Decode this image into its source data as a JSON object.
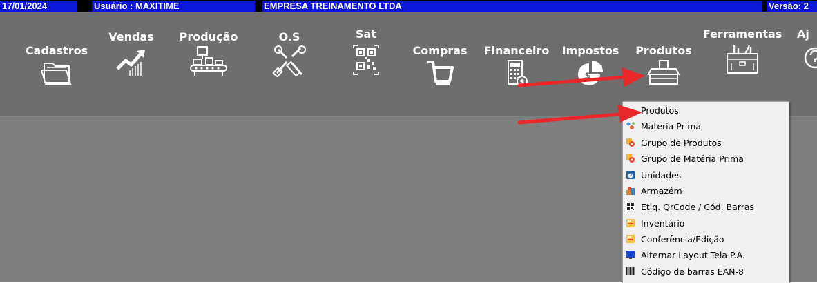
{
  "status_bar": {
    "date": "17/01/2024",
    "user": "Usuário : MAXITIME",
    "company": "EMPRESA TREINAMENTO LTDA",
    "version": "Versão: 2"
  },
  "menu": {
    "items": [
      {
        "label": "Cadastros",
        "icon": "folder-icon"
      },
      {
        "label": "Vendas",
        "icon": "trend-up-icon"
      },
      {
        "label": "Produção",
        "icon": "conveyor-icon"
      },
      {
        "label": "O.S",
        "icon": "tools-icon"
      },
      {
        "label": "Sat",
        "icon": "qrcode-icon"
      },
      {
        "label": "Compras",
        "icon": "cart-icon"
      },
      {
        "label": "Financeiro",
        "icon": "calculator-icon"
      },
      {
        "label": "Impostos",
        "icon": "pie-chart-icon"
      },
      {
        "label": "Produtos",
        "icon": "product-box-icon"
      },
      {
        "label": "Ferramentas",
        "icon": "toolbox-icon"
      },
      {
        "label": "Aj",
        "icon": "help-icon"
      }
    ]
  },
  "dropdown": {
    "items": [
      {
        "label": "Produtos",
        "icon": "product-icon"
      },
      {
        "label": "Matéria Prima",
        "icon": "raw-material-icon"
      },
      {
        "label": "Grupo de Produtos",
        "icon": "product-group-icon"
      },
      {
        "label": "Grupo de Matéria Prima",
        "icon": "raw-material-group-icon"
      },
      {
        "label": "Unidades",
        "icon": "scale-icon"
      },
      {
        "label": "Armazém",
        "icon": "warehouse-icon"
      },
      {
        "label": "Etiq. QrCode / Cód. Barras",
        "icon": "qrcode-label-icon"
      },
      {
        "label": "Inventário",
        "icon": "inventory-icon"
      },
      {
        "label": "Conferência/Edição",
        "icon": "check-edit-icon"
      },
      {
        "label": "Alternar Layout Tela P.A.",
        "icon": "monitor-icon"
      },
      {
        "label": "Código de barras EAN-8",
        "icon": "barcode-icon"
      }
    ]
  },
  "colors": {
    "status_bar_segment": "#0b16d9",
    "toolbar": "#6e6e6e",
    "workspace": "#7f7f7f",
    "dropdown_bg": "#f0f0f0",
    "annotation_arrow": "#e8282b"
  }
}
